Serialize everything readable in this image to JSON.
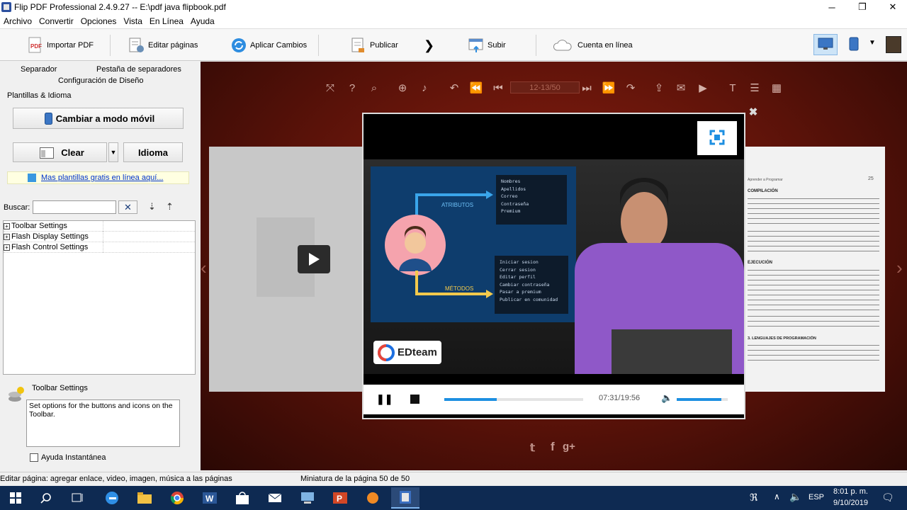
{
  "window": {
    "title": "Flip PDF Professional 2.4.9.27 -- E:\\pdf java flipbook.pdf",
    "minimize": "─",
    "maximize": "❐",
    "close": "✕"
  },
  "menu": [
    "Archivo",
    "Convertir",
    "Opciones",
    "Vista",
    "En Línea",
    "Ayuda"
  ],
  "toolbar": {
    "import_pdf": "Importar PDF",
    "edit_pages": "Editar páginas",
    "apply_changes": "Aplicar Cambios",
    "publish": "Publicar",
    "upload": "Subir",
    "online_account": "Cuenta en línea"
  },
  "left": {
    "tab_separator": "Separador",
    "tab_separator_tab": "Pestaña de separadores",
    "design_config": "Configuración de Diseño",
    "templates_group": "Plantillas & Idioma",
    "mobile_button": "Cambiar a modo móvil",
    "clear_button": "Clear",
    "language_button": "Idioma",
    "templates_link": "Mas plantillas gratis en línea aquí...",
    "search_label": "Buscar:",
    "search_value": "",
    "tree": [
      "Toolbar Settings",
      "Flash Display Settings",
      "Flash Control Settings"
    ],
    "info_title": "Toolbar Settings",
    "info_text": "Set options for the buttons and icons on the Toolbar.",
    "instant_help": "Ayuda Instantánea"
  },
  "viewer": {
    "page_indicator": "12-13/50",
    "video": {
      "slide_attr_label": "ATRIBUTOS",
      "slide_method_label": "MÉTODOS",
      "attributes": [
        "Nombres",
        "Apellidos",
        "Correo",
        "Contraseña",
        "Premium"
      ],
      "methods": [
        "Iniciar sesion",
        "Cerrar sesion",
        "Editar perfil",
        "Cambiar contraseña",
        "Pasar a premium",
        "Publicar en comunidad"
      ],
      "brand": "EDteam",
      "time": "07:31/19:56",
      "progress": 0.38,
      "volume": 0.87
    },
    "page_right": {
      "header_left": "Aprender a Programar",
      "page_number": "25",
      "heading1": "COMPILACIÓN",
      "heading2": "EJECUCIÓN",
      "heading3": "3. LENGUAJES DE PROGRAMACIÓN"
    }
  },
  "status": {
    "left": "Editar página: agregar enlace, video, imagen, música a las páginas",
    "middle": "Miniatura de la página 50 de 50"
  },
  "taskbar": {
    "lang": "ESP",
    "time": "8:01 p. m.",
    "date": "9/10/2019"
  },
  "colors": {
    "accent": "#1d8fe1",
    "viewer_bg": "#5a1209",
    "slide_bg": "#0e3d6d",
    "taskbar": "#0e2a52"
  }
}
